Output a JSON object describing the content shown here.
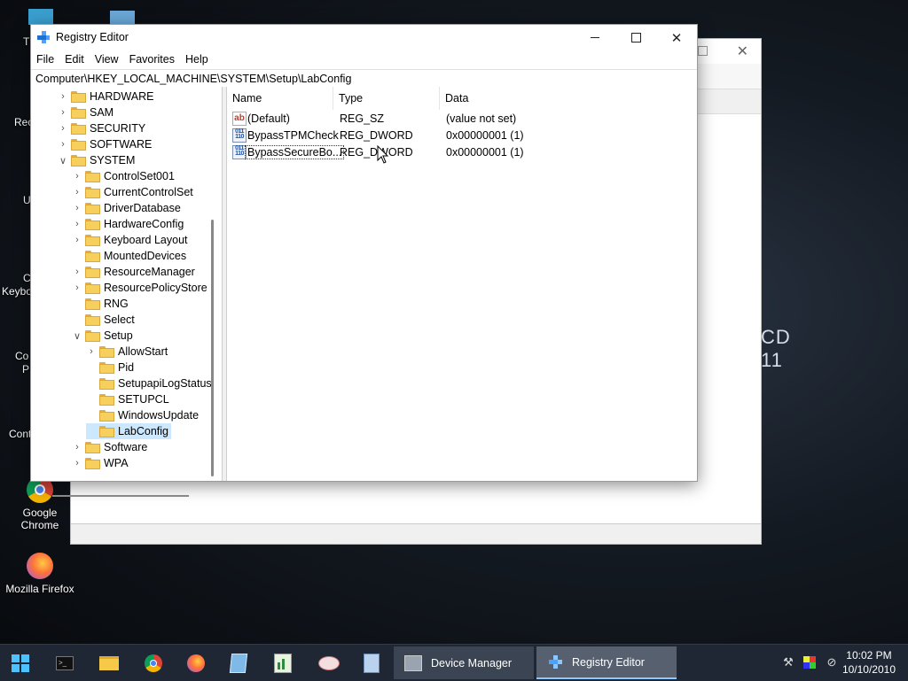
{
  "desktop": {
    "icons": [
      {
        "label": "Google Chrome"
      },
      {
        "label": "Mozilla Firefox"
      }
    ],
    "clipped": {
      "t1": "Th",
      "rec": "Rec",
      "u": "U",
      "keyb1": "C",
      "keyb2": "Keyboa",
      "con1": "Co",
      "con2": "P",
      "cont": "Cont"
    },
    "bg_window_text": [
      "CD",
      "11"
    ]
  },
  "regedit": {
    "title": "Registry Editor",
    "menu": [
      "File",
      "Edit",
      "View",
      "Favorites",
      "Help"
    ],
    "address": "Computer\\HKEY_LOCAL_MACHINE\\SYSTEM\\Setup\\LabConfig",
    "tree": [
      {
        "label": "HARDWARE",
        "chev": ">"
      },
      {
        "label": "SAM",
        "chev": ">"
      },
      {
        "label": "SECURITY",
        "chev": ">"
      },
      {
        "label": "SOFTWARE",
        "chev": ">"
      },
      {
        "label": "SYSTEM",
        "chev": "v"
      },
      {
        "label": "ControlSet001",
        "chev": ">"
      },
      {
        "label": "CurrentControlSet",
        "chev": ">"
      },
      {
        "label": "DriverDatabase",
        "chev": ">"
      },
      {
        "label": "HardwareConfig",
        "chev": ">"
      },
      {
        "label": "Keyboard Layout",
        "chev": ">"
      },
      {
        "label": "MountedDevices",
        "chev": ""
      },
      {
        "label": "ResourceManager",
        "chev": ">"
      },
      {
        "label": "ResourcePolicyStore",
        "chev": ">"
      },
      {
        "label": "RNG",
        "chev": ""
      },
      {
        "label": "Select",
        "chev": ""
      },
      {
        "label": "Setup",
        "chev": "v"
      },
      {
        "label": "AllowStart",
        "chev": ">"
      },
      {
        "label": "Pid",
        "chev": ""
      },
      {
        "label": "SetupapiLogStatus",
        "chev": ""
      },
      {
        "label": "SETUPCL",
        "chev": ""
      },
      {
        "label": "WindowsUpdate",
        "chev": ""
      },
      {
        "label": "LabConfig",
        "chev": ""
      },
      {
        "label": "Software",
        "chev": ">"
      },
      {
        "label": "WPA",
        "chev": ">"
      }
    ],
    "columns": {
      "name": "Name",
      "type": "Type",
      "data": "Data"
    },
    "values": [
      {
        "name": "(Default)",
        "type": "REG_SZ",
        "data": "(value not set)",
        "icon": "string-value-icon"
      },
      {
        "name": "BypassTPMCheck",
        "type": "REG_DWORD",
        "data": "0x00000001 (1)",
        "icon": "dword-value-icon"
      },
      {
        "name": "BypassSecureBo...",
        "type": "REG_DWORD",
        "data": "0x00000001 (1)",
        "icon": "dword-value-icon"
      }
    ]
  },
  "taskbar": {
    "apps": [
      {
        "label": "Device Manager"
      },
      {
        "label": "Registry Editor"
      }
    ],
    "clock": {
      "time": "10:02 PM",
      "date": "10/10/2010"
    }
  }
}
